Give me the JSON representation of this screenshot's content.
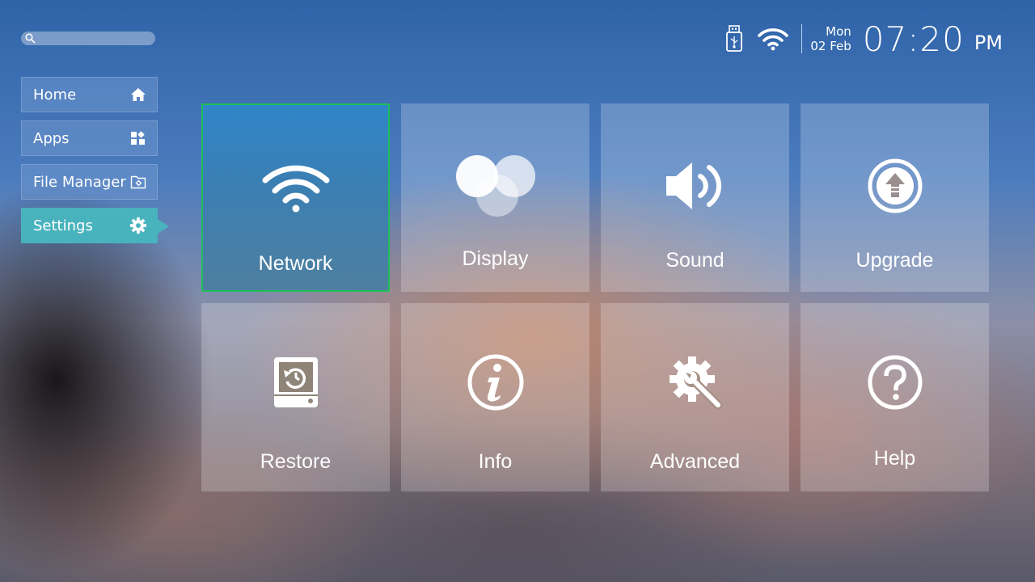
{
  "search": {
    "placeholder": ""
  },
  "sidebar": {
    "items": [
      {
        "label": "Home",
        "icon": "home-icon"
      },
      {
        "label": "Apps",
        "icon": "apps-icon"
      },
      {
        "label": "File Manager",
        "icon": "folder-gear-icon"
      },
      {
        "label": "Settings",
        "icon": "gear-icon",
        "active": true
      }
    ]
  },
  "status": {
    "day": "Mon",
    "date": "02 Feb",
    "time": "07:20",
    "ampm": "PM",
    "icons": [
      "usb-icon",
      "wifi-icon"
    ]
  },
  "tiles": [
    {
      "label": "Network",
      "icon": "wifi-icon",
      "focused": true
    },
    {
      "label": "Display",
      "icon": "display-circles-icon"
    },
    {
      "label": "Sound",
      "icon": "speaker-icon"
    },
    {
      "label": "Upgrade",
      "icon": "upgrade-arrow-icon"
    },
    {
      "label": "Restore",
      "icon": "restore-drive-icon"
    },
    {
      "label": "Info",
      "icon": "info-icon"
    },
    {
      "label": "Advanced",
      "icon": "gear-wrench-icon"
    },
    {
      "label": "Help",
      "icon": "help-icon"
    }
  ],
  "colors": {
    "active_sidebar": "#49b3bd",
    "focus_border": "#1fbf5a",
    "focused_tile": "#2f86c8"
  }
}
